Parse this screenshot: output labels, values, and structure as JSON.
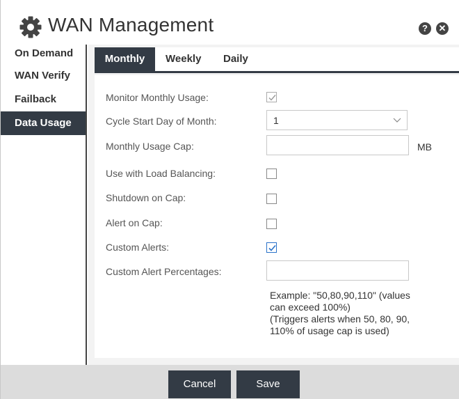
{
  "header": {
    "title": "WAN Management",
    "icon": "gear-icon",
    "help_icon": "help-icon",
    "close_icon": "close-icon",
    "help_glyph": "?",
    "close_glyph": "✕"
  },
  "sidebar": {
    "items": [
      {
        "label": "On Demand",
        "active": false
      },
      {
        "label": "WAN Verify",
        "active": false
      },
      {
        "label": "Failback",
        "active": false
      },
      {
        "label": "Data Usage",
        "active": true
      }
    ]
  },
  "tabs": [
    {
      "label": "Monthly",
      "active": true
    },
    {
      "label": "Weekly",
      "active": false
    },
    {
      "label": "Daily",
      "active": false
    }
  ],
  "form": {
    "monitor_monthly_usage": {
      "label": "Monitor Monthly Usage:",
      "checked": true,
      "disabled": true
    },
    "cycle_start_day": {
      "label": "Cycle Start Day of Month:",
      "value": "1"
    },
    "monthly_usage_cap": {
      "label": "Monthly Usage Cap:",
      "value": "",
      "unit": "MB"
    },
    "use_with_load_balancing": {
      "label": "Use with Load Balancing:",
      "checked": false
    },
    "shutdown_on_cap": {
      "label": "Shutdown on Cap:",
      "checked": false
    },
    "alert_on_cap": {
      "label": "Alert on Cap:",
      "checked": false
    },
    "custom_alerts": {
      "label": "Custom Alerts:",
      "checked": true
    },
    "custom_alert_percentages": {
      "label": "Custom Alert Percentages:",
      "value": ""
    },
    "hint_lines": [
      "Example: \"50,80,90,110\" (values",
      "can exceed 100%)",
      "(Triggers alerts when 50, 80, 90,",
      "110% of usage cap is used)"
    ]
  },
  "footer": {
    "cancel_label": "Cancel",
    "save_label": "Save"
  },
  "colors": {
    "dark_accent": "#333b45",
    "check_blue": "#2a72c9",
    "footer_bg": "#dcdcdc"
  }
}
